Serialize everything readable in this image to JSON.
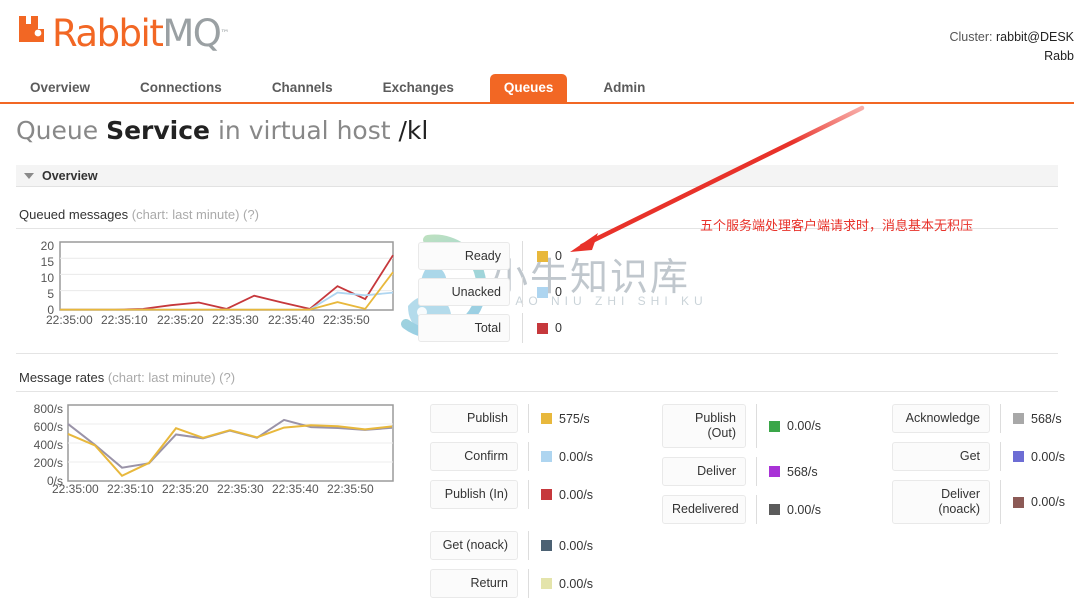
{
  "brand": {
    "name_part1": "Rabbit",
    "name_part2": "MQ",
    "tm": "™",
    "logo_icon": "rabbit-logo-icon",
    "orange": "#f26724",
    "grey": "#9aa0a3"
  },
  "header": {
    "cluster_label": "Cluster:",
    "cluster_value": "rabbit@DESK",
    "cluster_line2": "Rabb"
  },
  "nav": {
    "tabs": [
      {
        "label": "Overview",
        "active": false
      },
      {
        "label": "Connections",
        "active": false
      },
      {
        "label": "Channels",
        "active": false
      },
      {
        "label": "Exchanges",
        "active": false
      },
      {
        "label": "Queues",
        "active": true
      },
      {
        "label": "Admin",
        "active": false
      }
    ]
  },
  "page": {
    "title_prefix": "Queue ",
    "title_queue": "Service",
    "title_middle": " in virtual host ",
    "title_vhost": "/kl"
  },
  "overview_section": {
    "title": "Overview",
    "caret_icon": "chevron-down-icon"
  },
  "queued": {
    "heading": "Queued messages",
    "heading_muted": "(chart: last minute)",
    "help": "(?)",
    "legend": [
      {
        "name": "Ready",
        "value": "0",
        "color": "#e8b83c"
      },
      {
        "name": "Unacked",
        "value": "0",
        "color": "#aed5f0"
      },
      {
        "name": "Total",
        "value": "0",
        "color": "#c6383c"
      }
    ]
  },
  "rates": {
    "heading": "Message rates",
    "heading_muted": "(chart: last minute)",
    "help": "(?)",
    "columns": [
      {
        "items": [
          {
            "name": "Publish",
            "value": "575/s",
            "color": "#e8b83c",
            "gap": false
          },
          {
            "name": "Confirm",
            "value": "0.00/s",
            "color": "#aed5f0",
            "gap": false
          },
          {
            "name": "Publish (In)",
            "value": "0.00/s",
            "color": "#c6383c",
            "gap": false
          },
          {
            "name": "Get (noack)",
            "value": "0.00/s",
            "color": "#4c6173",
            "gap": true
          },
          {
            "name": "Return",
            "value": "0.00/s",
            "color": "#e4e4ab",
            "gap": false
          }
        ]
      },
      {
        "items": [
          {
            "name": "Publish\n(Out)",
            "value": "0.00/s",
            "color": "#3aa648",
            "gap": false
          },
          {
            "name": "Deliver",
            "value": "568/s",
            "color": "#a832d6",
            "gap": false
          },
          {
            "name": "Redelivered",
            "value": "0.00/s",
            "color": "#5b5b5b",
            "gap": false
          }
        ]
      },
      {
        "items": [
          {
            "name": "Acknowledge",
            "value": "568/s",
            "color": "#a8a8a8",
            "gap": false
          },
          {
            "name": "Get",
            "value": "0.00/s",
            "color": "#6d6dd4",
            "gap": false
          },
          {
            "name": "Deliver\n(noack)",
            "value": "0.00/s",
            "color": "#8c5a56",
            "gap": false
          }
        ]
      }
    ]
  },
  "annotation": {
    "text": "五个服务端处理客户端请求时，消息基本无积压",
    "color": "#e8322a",
    "arrow_icon": "arrow-pointer-icon"
  },
  "watermark": {
    "text": "小牛知识库",
    "subtext": "XIAO NIU ZHI SHI KU",
    "logo_icon": "ox-circle-logo-icon"
  },
  "chart_data": [
    {
      "type": "line",
      "title": "Queued messages",
      "id": "queued-messages",
      "xlabel": "",
      "ylabel": "",
      "grid": true,
      "legend_position": "right",
      "ylim": [
        0,
        20
      ],
      "yticks": [
        0,
        5,
        10,
        15,
        20
      ],
      "ytick_labels": [
        "0",
        "5",
        "10",
        "15",
        "20"
      ],
      "xticks": [
        "22:35:00",
        "22:35:10",
        "22:35:20",
        "22:35:30",
        "22:35:40",
        "22:35:50"
      ],
      "x": [
        0,
        5,
        10,
        15,
        20,
        25,
        30,
        35,
        40,
        45,
        50,
        55,
        60
      ],
      "series": [
        {
          "name": "Total",
          "color": "#c6383c",
          "values": [
            0,
            0,
            0,
            0.2,
            1.4,
            2.2,
            0.2,
            4.2,
            2.2,
            0.2,
            7,
            3.2,
            16
          ]
        },
        {
          "name": "Unacked",
          "color": "#aed5f0",
          "values": [
            0,
            0,
            0,
            0,
            0,
            0,
            0,
            0,
            0,
            0,
            5,
            4.2,
            5
          ]
        },
        {
          "name": "Ready",
          "color": "#e8b83c",
          "values": [
            0,
            0,
            0,
            0,
            0,
            0,
            0,
            0,
            0,
            0,
            2.2,
            0.2,
            11
          ]
        }
      ]
    },
    {
      "type": "line",
      "title": "Message rates",
      "id": "message-rates",
      "xlabel": "",
      "ylabel": "",
      "grid": true,
      "legend_position": "right",
      "ylim": [
        0,
        800
      ],
      "yticks": [
        0,
        200,
        400,
        600,
        800
      ],
      "ytick_labels": [
        "0/s",
        "200/s",
        "400/s",
        "600/s",
        "800/s"
      ],
      "xticks": [
        "22:35:00",
        "22:35:10",
        "22:35:20",
        "22:35:30",
        "22:35:40",
        "22:35:50"
      ],
      "x": [
        0,
        5,
        10,
        15,
        20,
        25,
        30,
        35,
        40,
        45,
        50,
        55,
        60
      ],
      "series": [
        {
          "name": "Publish",
          "color": "#e8b83c",
          "values": [
            495,
            375,
            55,
            170,
            555,
            455,
            535,
            470,
            565,
            590,
            580,
            545,
            575
          ]
        },
        {
          "name": "Acknowledge",
          "color": "#9a93a8",
          "values": [
            600,
            380,
            140,
            165,
            490,
            450,
            530,
            455,
            640,
            565,
            555,
            545,
            568
          ]
        }
      ]
    }
  ]
}
